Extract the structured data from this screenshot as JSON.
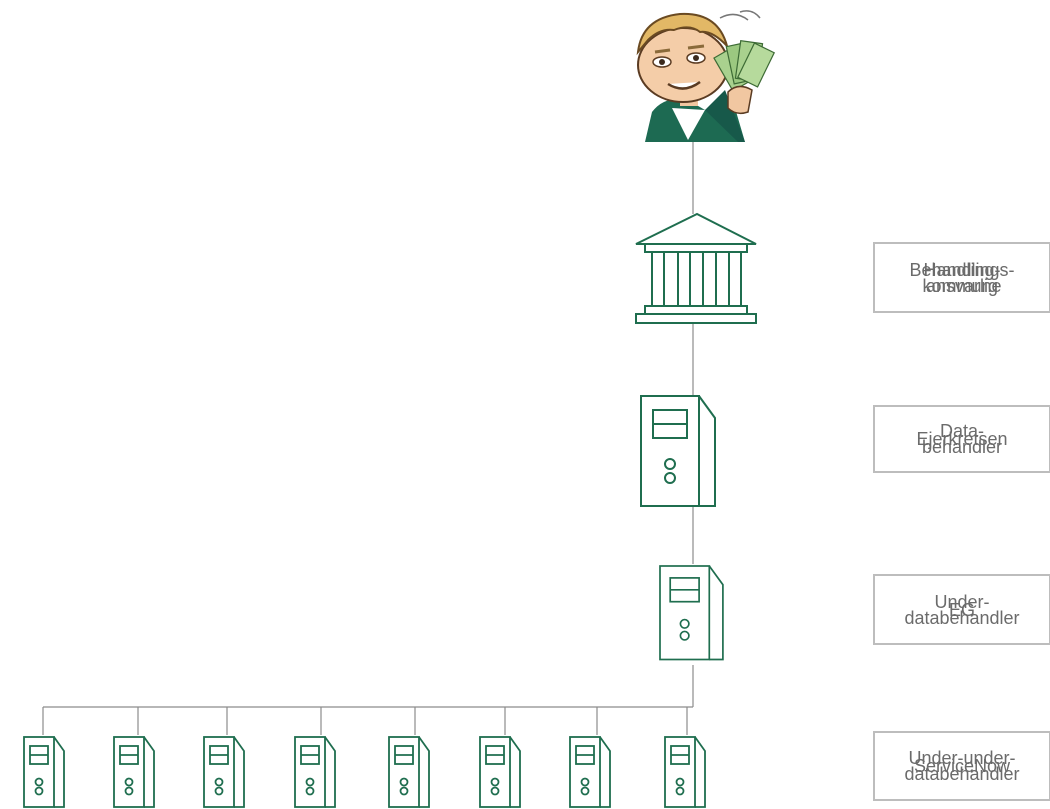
{
  "colors": {
    "icon_stroke": "#1f6e4f",
    "connector": "#8c8c8c",
    "label_border": "#bdbdbd",
    "label_text": "#6b6b6b"
  },
  "icons": {
    "top": "cartoon-person-with-money",
    "institution": "bank-building-icon",
    "server": "server-tower-icon"
  },
  "labels": {
    "row1_a": "Behandlings-\nansvarlig",
    "row1_b": "Handling-\nkommune",
    "row2_a": "Data-\nbehandler",
    "row2_b": "Ejerkretsen",
    "row3_a": "Under-\ndatabehandler",
    "row3_b": "EG",
    "row4_a": "Under-under-\ndatabehandler",
    "row4_b": "ServiceNow"
  }
}
